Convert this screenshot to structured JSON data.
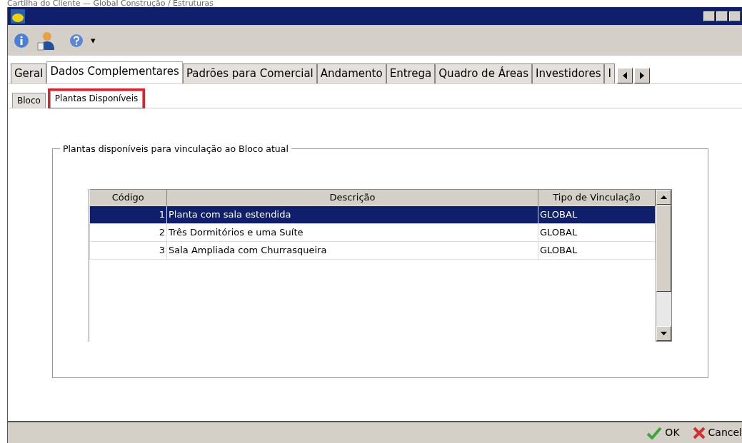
{
  "caption": "Cartilha do Cliente — Global Construção / Estruturas",
  "toolbar": {
    "dropdown_arrow": "▾"
  },
  "tabs": [
    {
      "label": "Geral",
      "selected": false
    },
    {
      "label": "Dados Complementares",
      "selected": true
    },
    {
      "label": "Padrões para Comercial",
      "selected": false
    },
    {
      "label": "Andamento",
      "selected": false
    },
    {
      "label": "Entrega",
      "selected": false
    },
    {
      "label": "Quadro de Áreas",
      "selected": false
    },
    {
      "label": "Investidores",
      "selected": false
    },
    {
      "label": "I",
      "selected": false
    }
  ],
  "subtabs": [
    {
      "label": "Bloco",
      "selected": false,
      "highlighted": false
    },
    {
      "label": "Plantas Disponíveis",
      "selected": true,
      "highlighted": true
    }
  ],
  "group": {
    "title": "Plantas disponíveis para vinculação ao Bloco atual"
  },
  "table": {
    "columns": [
      "Código",
      "Descrição",
      "Tipo de Vinculação"
    ],
    "rows": [
      {
        "cells": [
          "1",
          "Planta com sala estendida",
          "GLOBAL"
        ],
        "selected": true
      },
      {
        "cells": [
          "2",
          "Três Dormitórios e uma Suíte",
          "GLOBAL"
        ],
        "selected": false
      },
      {
        "cells": [
          "3",
          "Sala Ampliada com Churrasqueira",
          "GLOBAL"
        ],
        "selected": false
      }
    ]
  },
  "buttons": [
    {
      "kind": "ok",
      "label": "OK"
    },
    {
      "kind": "cancel",
      "label": "Cancel"
    }
  ]
}
